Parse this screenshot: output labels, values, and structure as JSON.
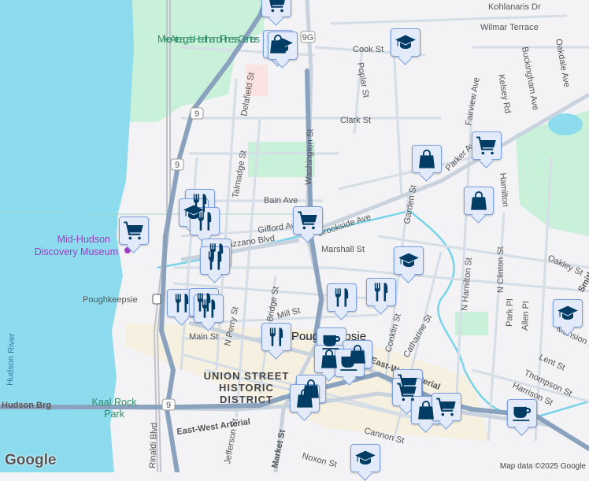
{
  "map": {
    "colors": {
      "water": "#8ddbee",
      "park": "#c9f0d8",
      "land": "#f3f2f4",
      "highway": "#8aa2bd",
      "marker_fill": "#e3ebfb",
      "marker_icon": "#003c64"
    },
    "streets": [
      "Kohlanaris Dr",
      "Wilmar Terrace",
      "Cook St",
      "Kelsey Rd",
      "Fairview Ave",
      "Buckingham Ave",
      "Oakdale Ave",
      "Poplar St",
      "Delafield St",
      "Clark St",
      "Washington St",
      "Parker Ave",
      "Talmadge St",
      "Bain Ave",
      "Garden St",
      "Hamilton",
      "Gifford Ave",
      "Brookside Ave",
      "Verrazzano Blvd",
      "Marshall St",
      "Oakley St",
      "N Clinton St",
      "N Hamilton St",
      "Smith",
      "Mill St",
      "N Perry St",
      "Park Pl",
      "Allen Pl",
      "Mansion St",
      "Main St",
      "Conklin St",
      "Catharine St",
      "Lent St",
      "Thompson St",
      "Harrison St",
      "East-West Arterial",
      "Jefferson St",
      "Market St",
      "Noxon St",
      "Cannon St",
      "Rinaldi Blvd",
      "Hudson Brg",
      "N Bridge St"
    ],
    "route_shields": [
      "9G",
      "9",
      "9",
      "9"
    ],
    "places": {
      "fitness": "Mike Arteaga's Health and Fitness Centers",
      "museum_line1": "Mid-Hudson",
      "museum_line2": "Discovery Museum",
      "station": "Poughkeepsie",
      "city": "Poughkeepsie",
      "district_line1": "UNION STREET",
      "district_line2": "HISTORIC",
      "district_line3": "DISTRICT",
      "park_line1": "Kaal Rock",
      "park_line2": "Park",
      "river": "Hudson River"
    },
    "markers": [
      "shopping-cart",
      "shopping-bag",
      "graduation-cap",
      "graduation-cap",
      "shopping-bag",
      "shopping-cart",
      "shopping-bag",
      "restaurant",
      "graduation-cap",
      "restaurant",
      "shopping-cart",
      "restaurant",
      "restaurant",
      "shopping-cart",
      "graduation-cap",
      "restaurant",
      "restaurant",
      "restaurant",
      "restaurant",
      "restaurant",
      "restaurant",
      "coffee",
      "shopping-bag",
      "shopping-bag",
      "coffee",
      "shopping-bag",
      "shopping-bag",
      "shopping-cart",
      "shopping-cart",
      "shopping-bag",
      "shopping-cart",
      "graduation-cap",
      "coffee",
      "graduation-cap"
    ]
  },
  "footer": {
    "logo": "Google",
    "attribution": "Map data ©2025 Google"
  }
}
